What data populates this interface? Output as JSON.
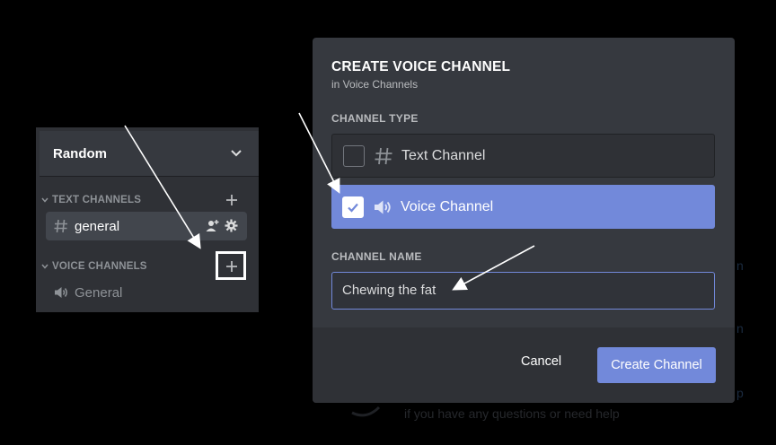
{
  "server": {
    "name": "Random",
    "categories": [
      {
        "label": "TEXT CHANNELS",
        "channels": [
          {
            "name": "general",
            "type": "text",
            "active": true
          }
        ]
      },
      {
        "label": "VOICE CHANNELS",
        "channels": [
          {
            "name": "General",
            "type": "voice",
            "active": false
          }
        ]
      }
    ]
  },
  "background_page": {
    "partial_text": "if you have any questions or need help"
  },
  "modal": {
    "title": "CREATE VOICE CHANNEL",
    "subtitle": "in Voice Channels",
    "channel_type_label": "CHANNEL TYPE",
    "types": [
      {
        "label": "Text Channel",
        "icon": "hash-icon",
        "selected": false
      },
      {
        "label": "Voice Channel",
        "icon": "speaker-icon",
        "selected": true
      }
    ],
    "channel_name_label": "CHANNEL NAME",
    "channel_name_value": "Chewing the fat",
    "cancel_label": "Cancel",
    "create_label": "Create Channel"
  },
  "colors": {
    "blurple": "#7289da",
    "panel": "#2f3136",
    "modal": "#36393f",
    "muted_text": "#8e9297"
  }
}
